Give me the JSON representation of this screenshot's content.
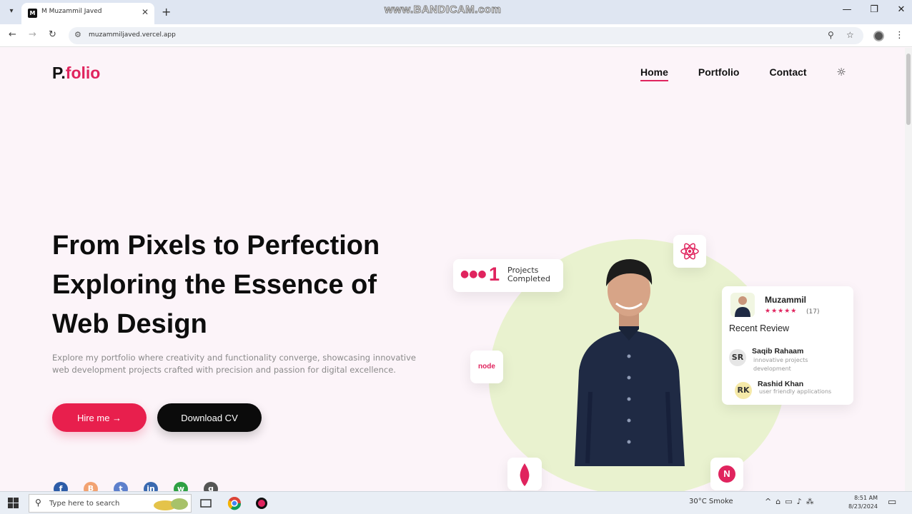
{
  "browser": {
    "tab_title": "M Muzammil Javed",
    "tab_favicon": "M",
    "new_tab_icon": "+",
    "url": "muzammiljaved.vercel.app",
    "watermark": "www.BANDICAM.com"
  },
  "header": {
    "logo_main": "P.",
    "logo_accent": "folio",
    "nav": [
      "Home",
      "Portfolio",
      "Contact"
    ],
    "theme_icon": "sun-icon"
  },
  "hero": {
    "headline": [
      "From Pixels to Perfection",
      "Exploring the Essence of",
      "Web Design"
    ],
    "intro": "Explore my portfolio where creativity and functionality converge, showcasing innovative web development projects crafted with precision and passion for digital excellence.",
    "hire_label": "Hire me →",
    "cv_label": "Download CV"
  },
  "projects_card": {
    "count": "1",
    "label_line1": "Projects",
    "label_line2": "Completed"
  },
  "tech_chips": {
    "node_label": "node",
    "next_label": "N"
  },
  "review_card": {
    "name": "Muzammil",
    "stars": "★★★★★",
    "rating": "(17)",
    "heading": "Recent Review",
    "reviews": [
      {
        "initials": "SR",
        "name": "Saqib Rahaam",
        "text": "innovative projects development",
        "color": "#e6e6e6"
      },
      {
        "initials": "RK",
        "name": "Rashid Khan",
        "text": "user friendly applications",
        "color": "#f5e9a8"
      }
    ]
  },
  "socials": [
    {
      "icon": "facebook-icon",
      "glyph": "f",
      "color": "#2d5ca8"
    },
    {
      "icon": "blogger-icon",
      "glyph": "B",
      "color": "#f2a272"
    },
    {
      "icon": "twitter-icon",
      "glyph": "t",
      "color": "#5d7fcc"
    },
    {
      "icon": "linkedin-icon",
      "glyph": "in",
      "color": "#3a69b0"
    },
    {
      "icon": "whatsapp-icon",
      "glyph": "w",
      "color": "#2ea043"
    },
    {
      "icon": "github-icon",
      "glyph": "g",
      "color": "#555555"
    }
  ],
  "taskbar": {
    "search_placeholder": "Type here to search",
    "weather": "30°C  Smoke",
    "time": "8:51 AM",
    "date": "8/23/2024"
  },
  "colors": {
    "accent": "#e0245e",
    "hire_button": "#e81f4d",
    "cv_button": "#0b0b0b",
    "blob": "#e9f2cf"
  }
}
